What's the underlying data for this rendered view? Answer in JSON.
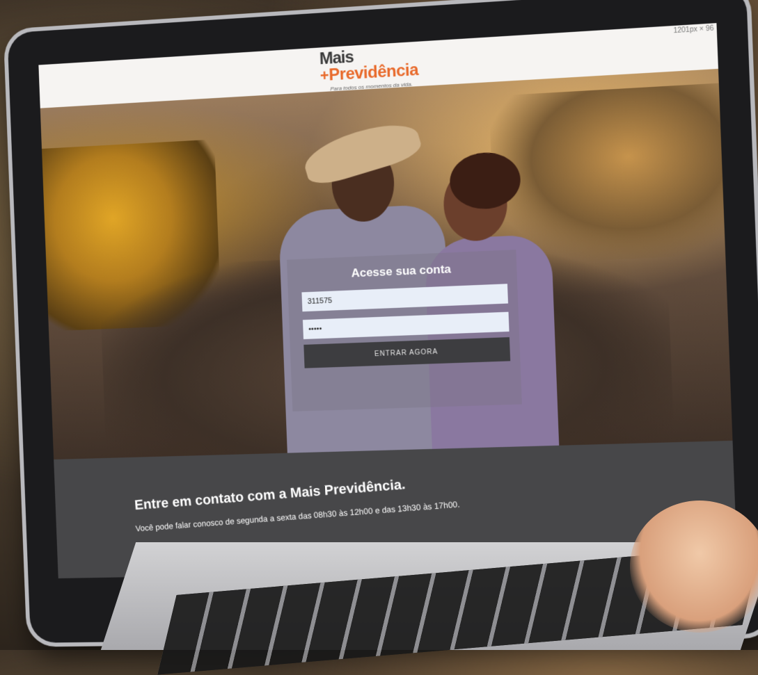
{
  "header": {
    "logo_line1": "Mais",
    "logo_line2": "Previdência",
    "logo_plus": "+",
    "tagline": "Para todos os momentos da vida.",
    "resolution_label": "1201px × 96"
  },
  "login": {
    "title": "Acesse sua conta",
    "user_value": "311575",
    "password_value": "•••••",
    "submit_label": "ENTRAR AGORA"
  },
  "contact": {
    "title": "Entre em contato com a Mais Previdência.",
    "text": "Você pode falar conosco de segunda a sexta das 08h30 às 12h00 e das 13h30 às 17h00."
  },
  "colors": {
    "brand_orange": "#e8692a",
    "brand_dark": "#3a3a3a",
    "contact_bg": "#474749",
    "button_bg": "#3d3d40"
  }
}
